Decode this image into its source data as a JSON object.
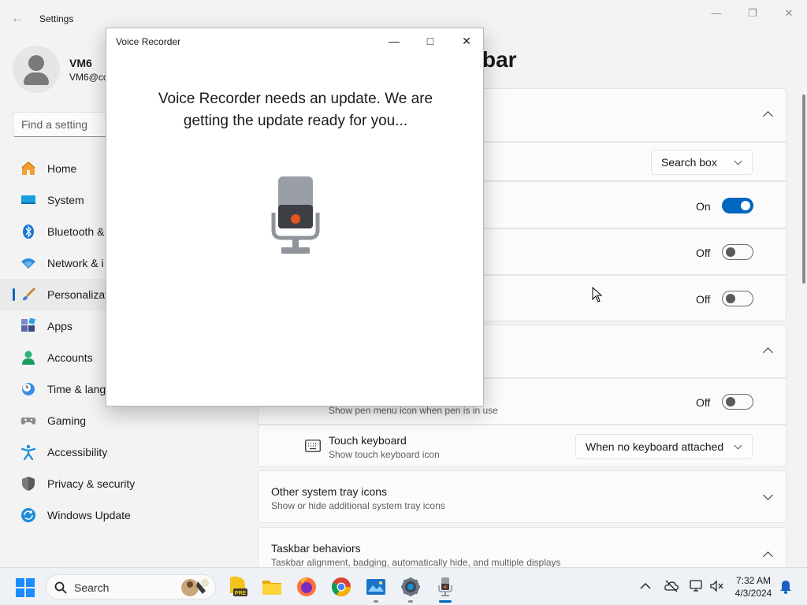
{
  "settings": {
    "window_title": "Settings",
    "profile": {
      "name": "VM6",
      "email": "VM6@co"
    },
    "search_placeholder": "Find a setting",
    "page_title_fragment": "bar",
    "nav": [
      {
        "label": "Home",
        "icon": "home-icon"
      },
      {
        "label": "System",
        "icon": "system-icon"
      },
      {
        "label": "Bluetooth &",
        "icon": "bluetooth-icon"
      },
      {
        "label": "Network & i",
        "icon": "wifi-icon"
      },
      {
        "label": "Personalizat",
        "icon": "paintbrush-icon",
        "selected": true
      },
      {
        "label": "Apps",
        "icon": "apps-icon"
      },
      {
        "label": "Accounts",
        "icon": "accounts-icon"
      },
      {
        "label": "Time & lang",
        "icon": "clock-globe-icon"
      },
      {
        "label": "Gaming",
        "icon": "gamepad-icon"
      },
      {
        "label": "Accessibility",
        "icon": "accessibility-icon"
      },
      {
        "label": "Privacy & security",
        "icon": "shield-icon"
      },
      {
        "label": "Windows Update",
        "icon": "update-icon"
      }
    ],
    "search_mode_value": "Search box",
    "toggle_1_state": "On",
    "toggle_2_state": "Off",
    "toggle_3_state": "Off",
    "pen_menu": {
      "subtitle": "Show pen menu icon when pen is in use",
      "state": "Off"
    },
    "touch_keyboard": {
      "title": "Touch keyboard",
      "subtitle": "Show touch keyboard icon",
      "value": "When no keyboard attached"
    },
    "other_tray": {
      "title": "Other system tray icons",
      "subtitle": "Show or hide additional system tray icons"
    },
    "taskbar_behaviors": {
      "title": "Taskbar behaviors",
      "subtitle": "Taskbar alignment, badging, automatically hide, and multiple displays"
    }
  },
  "voice_recorder": {
    "window_title": "Voice Recorder",
    "message": "Voice Recorder needs an update. We are getting the update ready for you..."
  },
  "taskbar": {
    "search_label": "Search",
    "time": "7:32 AM",
    "date": "4/3/2024",
    "apps": [
      "start-icon",
      "search-icon",
      "widgets-icon",
      "pre-app-icon",
      "file-explorer-icon",
      "firefox-icon",
      "chrome-icon",
      "image-viewer-icon",
      "settings-icon",
      "voice-recorder-icon"
    ]
  },
  "colors": {
    "accent": "#0067c0",
    "bg": "#f3f3f3"
  }
}
